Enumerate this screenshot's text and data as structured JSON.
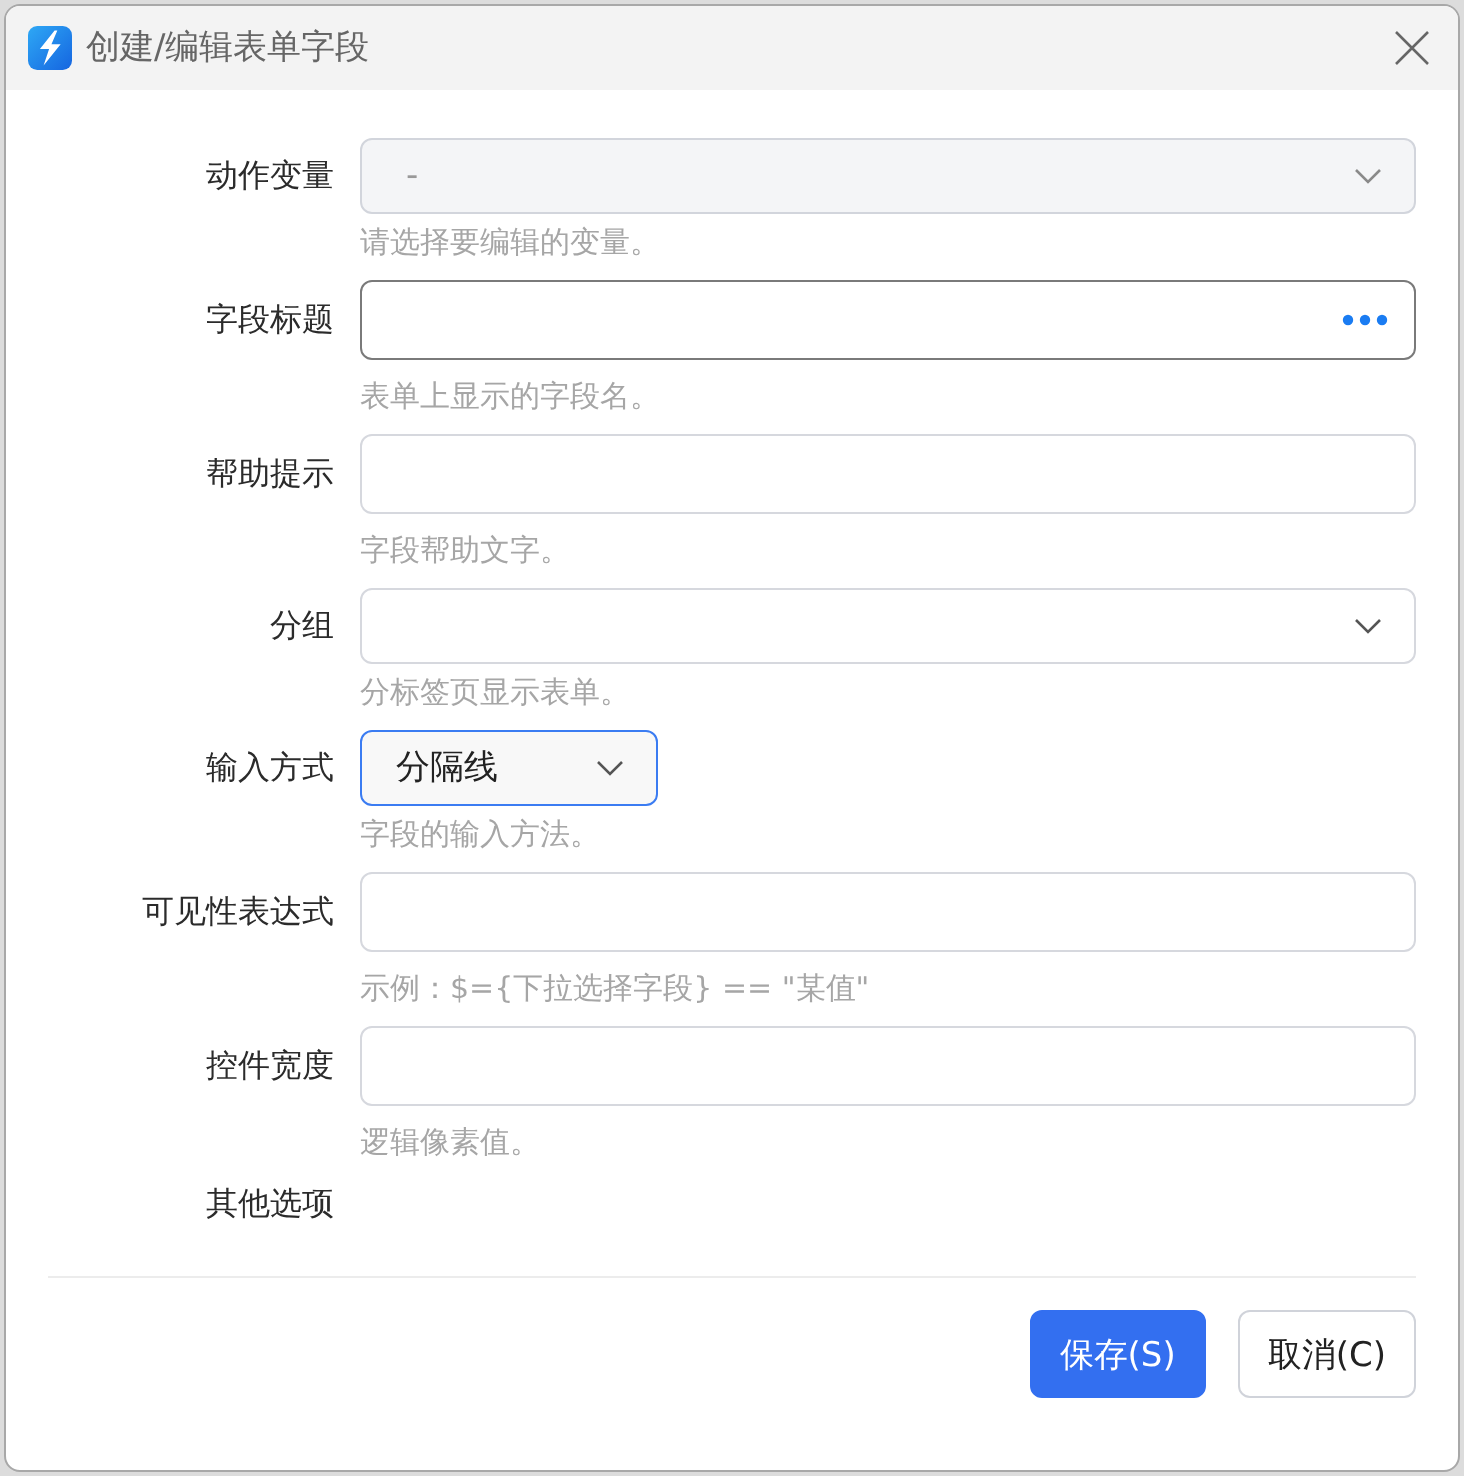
{
  "window": {
    "title": "创建/编辑表单字段"
  },
  "fields": [
    {
      "label": "动作变量",
      "kind": "select",
      "value": "-",
      "disabled": true,
      "focused": false,
      "hovered": false,
      "hint": "请选择要编辑的变量。"
    },
    {
      "label": "字段标题",
      "kind": "input-more",
      "disabled": false,
      "focused": false,
      "hovered": true,
      "hint": "表单上显示的字段名。"
    },
    {
      "label": "帮助提示",
      "kind": "input",
      "disabled": false,
      "focused": false,
      "hovered": false,
      "hint": "字段帮助文字。"
    },
    {
      "label": "分组",
      "kind": "select",
      "disabled": false,
      "focused": false,
      "hovered": false,
      "hint": "分标签页显示表单。"
    },
    {
      "label": "输入方式",
      "kind": "short-select",
      "value": "分隔线",
      "disabled": false,
      "focused": true,
      "hovered": false,
      "hint": "字段的输入方法。"
    },
    {
      "label": "可见性表达式",
      "kind": "input",
      "disabled": false,
      "focused": false,
      "hovered": false,
      "hint": "示例：$={下拉选择字段} == \"某值\""
    },
    {
      "label": "控件宽度",
      "kind": "input",
      "disabled": false,
      "focused": false,
      "hovered": false,
      "hint": "逻辑像素值。"
    }
  ],
  "section_label": "其他选项",
  "buttons": [
    {
      "label": "保存(S)",
      "kind": "primary"
    },
    {
      "label": "取消(C)",
      "kind": "secondary"
    }
  ]
}
